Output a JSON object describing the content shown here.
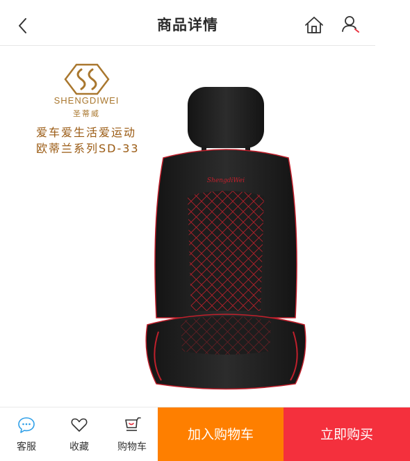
{
  "header": {
    "title": "商品详情",
    "back_icon": "chevron-left-icon",
    "home_icon": "home-icon",
    "user_icon": "user-icon"
  },
  "product": {
    "brand_name": "SHENGDIWEI",
    "brand_cn": "圣蒂威",
    "slogan_line1": "爱车爱生活爱运动",
    "slogan_line2": "欧蒂兰系列SD-33",
    "seat_emblem": "ShengdiWei",
    "brand_color": "#a9772e",
    "slogan_color": "#9a5a12"
  },
  "bottom_bar": {
    "service_label": "客服",
    "favorite_label": "收藏",
    "cart_label": "购物车",
    "add_to_cart_label": "加入购物车",
    "buy_now_label": "立即购买",
    "add_to_cart_color": "#fe7f00",
    "buy_now_color": "#f4303d"
  }
}
